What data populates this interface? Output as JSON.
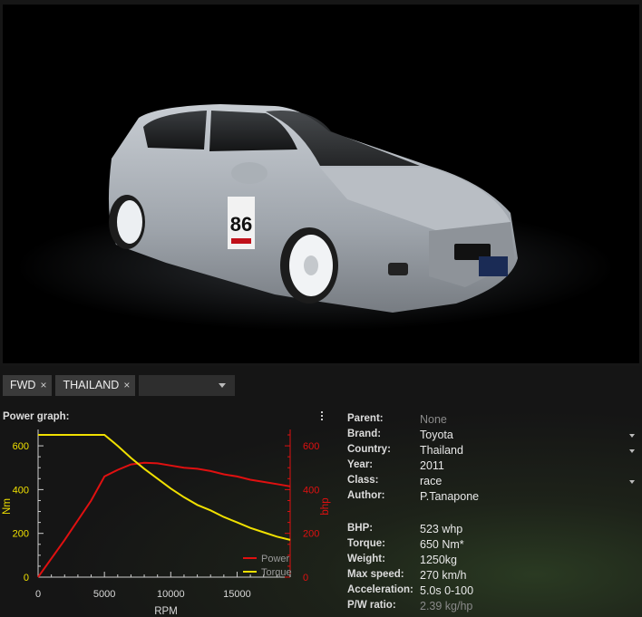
{
  "tags": {
    "items": [
      {
        "label": "FWD",
        "remove": "×"
      },
      {
        "label": "THAILAND",
        "remove": "×"
      }
    ],
    "select_value": ""
  },
  "graph": {
    "title": "Power graph:",
    "menu_icon": "more-vertical-icon",
    "colors": {
      "power": "#e01010",
      "torque": "#f0e000",
      "axis_left": "#f0e000",
      "axis_right": "#e01010"
    }
  },
  "chart_data": {
    "type": "line",
    "x": [
      0,
      2000,
      4000,
      5000,
      6000,
      7000,
      8000,
      9000,
      10000,
      11000,
      12000,
      13000,
      14000,
      15000,
      16000,
      17000,
      18000,
      19000
    ],
    "series": [
      {
        "name": "Power",
        "axis": "right",
        "values": [
          0,
          170,
          350,
          460,
          490,
          515,
          523,
          520,
          510,
          500,
          495,
          485,
          470,
          460,
          445,
          435,
          425,
          415
        ]
      },
      {
        "name": "Torque",
        "axis": "left",
        "values": [
          650,
          650,
          650,
          650,
          600,
          545,
          495,
          450,
          405,
          365,
          330,
          305,
          275,
          250,
          225,
          205,
          185,
          170
        ]
      }
    ],
    "xlabel": "RPM",
    "ylabel_left": "Nm",
    "ylabel_right": "bhp",
    "xlim": [
      0,
      19000
    ],
    "ylim_left": [
      0,
      650
    ],
    "ylim_right": [
      0,
      650
    ],
    "x_ticks": [
      "0",
      "5000",
      "10000",
      "15000"
    ],
    "y_ticks_left": [
      "0",
      "200",
      "400",
      "600"
    ],
    "y_ticks_right": [
      "0",
      "200",
      "400",
      "600"
    ],
    "legend": "bottom-right"
  },
  "specs": {
    "menu_icon": "more-vertical-icon",
    "rows1": [
      {
        "key": "Parent:",
        "value": "None",
        "dim": true,
        "dropdown": false
      },
      {
        "key": "Brand:",
        "value": "Toyota",
        "dim": false,
        "dropdown": true
      },
      {
        "key": "Country:",
        "value": "Thailand",
        "dim": false,
        "dropdown": true
      },
      {
        "key": "Year:",
        "value": "2011",
        "dim": false,
        "dropdown": false
      },
      {
        "key": "Class:",
        "value": "race",
        "dim": false,
        "dropdown": true
      },
      {
        "key": "Author:",
        "value": "P.Tanapone",
        "dim": false,
        "dropdown": false
      }
    ],
    "rows2": [
      {
        "key": "BHP:",
        "value": "523 whp",
        "dim": false
      },
      {
        "key": "Torque:",
        "value": "650 Nm*",
        "dim": false
      },
      {
        "key": "Weight:",
        "value": "1250kg",
        "dim": false
      },
      {
        "key": "Max speed:",
        "value": "270 km/h",
        "dim": false
      },
      {
        "key": "Acceleration:",
        "value": "5.0s 0-100",
        "dim": false
      },
      {
        "key": "P/W ratio:",
        "value": "2.39 kg/hp",
        "dim": true
      }
    ]
  },
  "preview": {
    "car_number": "86"
  }
}
